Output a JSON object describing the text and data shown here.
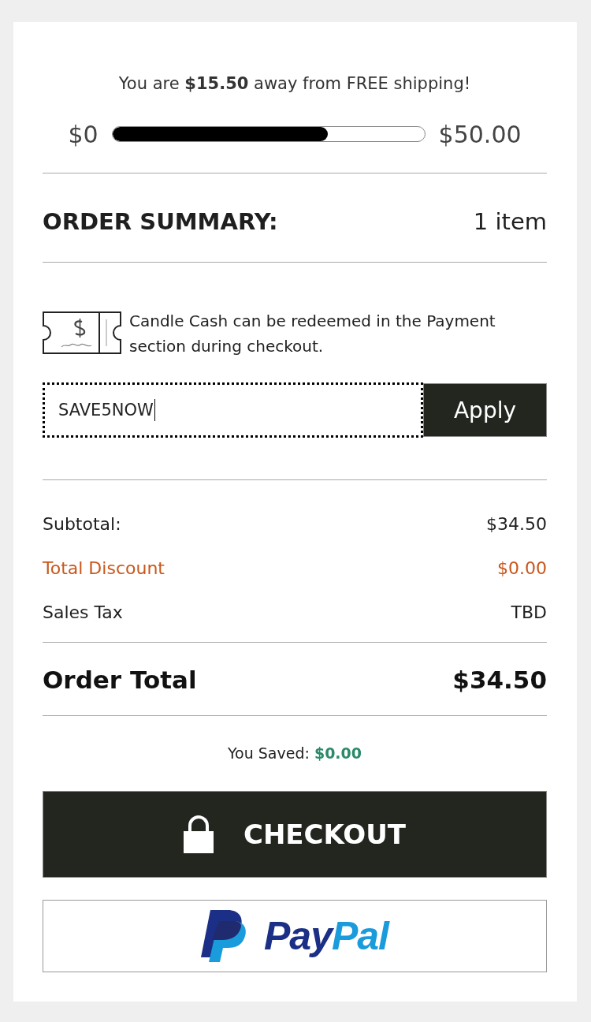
{
  "free_shipping": {
    "message": "You are **$15.50** away from FREE shipping!",
    "min_label": "$0",
    "max_label": "$50.00",
    "level": 0.69
  },
  "order_summary": {
    "title": "ORDER SUMMARY:",
    "item_count": "1 item"
  },
  "candle_cash": {
    "note": "Candle Cash can be redeemed in the Payment section during checkout."
  },
  "coupon": {
    "value": "SAVE5NOW",
    "focused": true,
    "button": "Apply"
  },
  "totals": {
    "rows": [
      {
        "label": "Subtotal:",
        "value": "$34.50",
        "color": "#1f1f1f"
      },
      {
        "label": "Total Discount",
        "value": "$0.00",
        "color": "#c9571c"
      },
      {
        "label": "Sales Tax",
        "value": "TBD",
        "color": "#1f1f1f"
      }
    ]
  },
  "order_total": {
    "label": "Order Total",
    "value": "$34.50"
  },
  "savings": {
    "label": "You Saved:",
    "value": "$0.00"
  },
  "checkout_button": {
    "label": "CHECKOUT"
  },
  "paypal_button": {
    "wordmark": [
      {
        "text": "Pay",
        "color": "#1b2f86"
      },
      {
        "text": "Pal",
        "color": "#1a9bdb"
      }
    ]
  }
}
